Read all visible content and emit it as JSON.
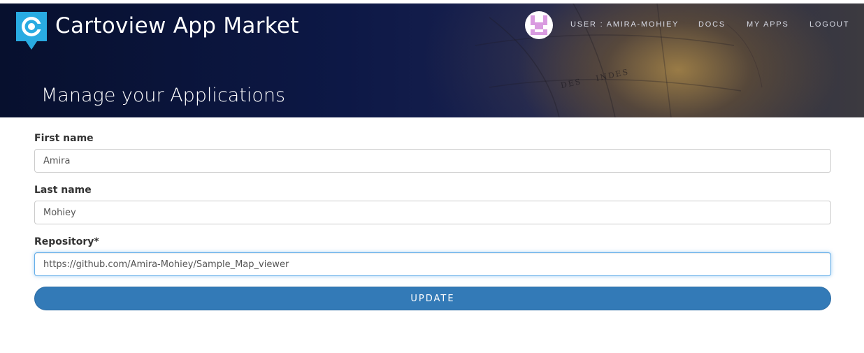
{
  "header": {
    "brand": "Cartoview App Market",
    "page_title": "Manage your Applications",
    "map_text": [
      "DES",
      "INDES"
    ]
  },
  "nav": {
    "user_label": "USER : AMIRA-MOHIEY",
    "docs_label": "DOCS",
    "my_apps_label": "MY APPS",
    "logout_label": "LOGOUT"
  },
  "form": {
    "first_name": {
      "label": "First name",
      "value": "Amira"
    },
    "last_name": {
      "label": "Last name",
      "value": "Mohiey"
    },
    "repository": {
      "label": "Repository*",
      "value": "https://github.com/Amira-Mohiey/Sample_Map_viewer"
    },
    "submit_label": "UPDATE"
  },
  "colors": {
    "logo": "#29abe2",
    "avatar_pattern": "#d99be0",
    "button": "#337ab7",
    "focus_border": "#66afe9"
  },
  "icons": {
    "logo": "cartoview-logo-icon",
    "avatar": "user-avatar-icon"
  }
}
